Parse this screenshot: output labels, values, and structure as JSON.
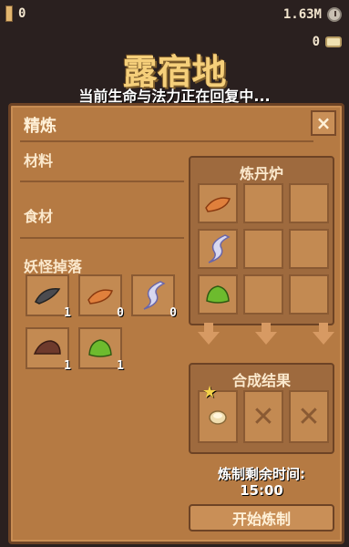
{
  "hud": {
    "keys": "0",
    "money": "1.63M",
    "coins": "0"
  },
  "location": {
    "title": "露宿地",
    "subtitle": "当前生命与法力正在回复中..."
  },
  "panel": {
    "title": "精炼",
    "close": "×",
    "sections": [
      "材料",
      "食材",
      "妖怪掉落"
    ],
    "items": [
      {
        "icon": "gray-scale-icon",
        "count": "1",
        "color": "#4b4b4f"
      },
      {
        "icon": "orange-scale-icon",
        "count": "0",
        "color": "#e0803c"
      },
      {
        "icon": "white-feather-icon",
        "count": "0",
        "color": "#d8d8f0"
      },
      {
        "icon": "brown-meat-icon",
        "count": "1",
        "color": "#6e3a2c"
      },
      {
        "icon": "green-slime-icon",
        "count": "1",
        "color": "#6dbb2e"
      }
    ]
  },
  "furnace": {
    "title": "炼丹炉",
    "slots": [
      "orange-scale-icon",
      "",
      "",
      "white-feather-icon",
      "",
      "",
      "green-slime-icon",
      "",
      ""
    ]
  },
  "result": {
    "title": "合成结果",
    "slots": [
      "pill-icon",
      "empty",
      "empty"
    ]
  },
  "timer": {
    "label": "炼制剩余时间:",
    "value": "15:00"
  },
  "start_button": "开始炼制",
  "colors": {
    "panel": "#b57a43",
    "border": "#6d4325",
    "title_gold": "#f5cf7a"
  }
}
